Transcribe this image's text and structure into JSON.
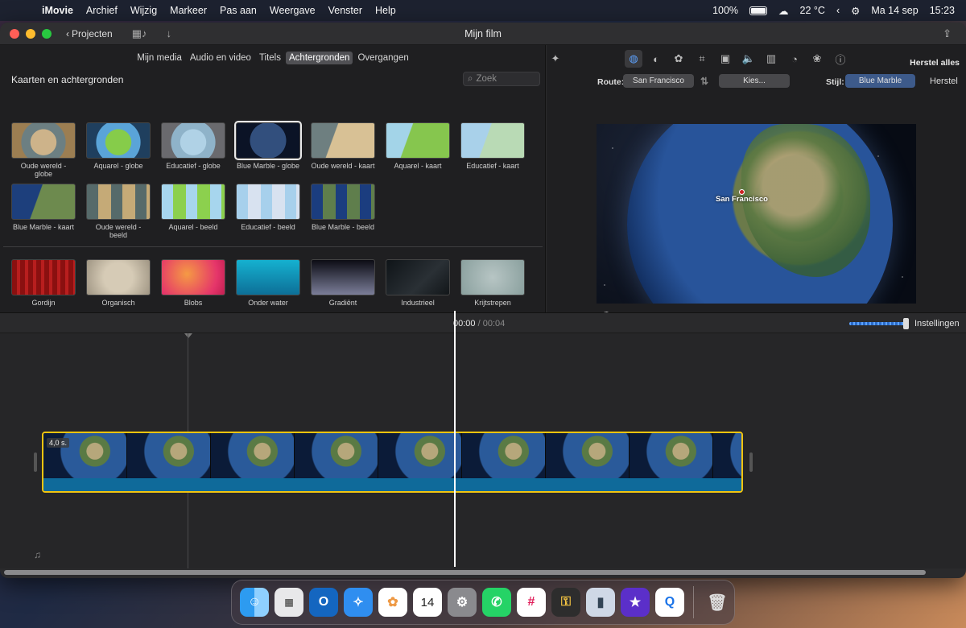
{
  "menubar": {
    "app": "iMovie",
    "items": [
      "Archief",
      "Wijzig",
      "Markeer",
      "Pas aan",
      "Weergave",
      "Venster",
      "Help"
    ],
    "battery": "100%",
    "weather": "22 °C",
    "date": "Ma 14 sep",
    "time": "15:23"
  },
  "titlebar": {
    "back_label": "Projecten",
    "title": "Mijn film"
  },
  "browser": {
    "tabs": [
      "Mijn media",
      "Audio en video",
      "Titels",
      "Achtergronden",
      "Overgangen"
    ],
    "active_tab": "Achtergronden",
    "header": "Kaarten en achtergronden",
    "search_placeholder": "Zoek",
    "maps": [
      "Oude wereld - globe",
      "Aquarel - globe",
      "Educatief - globe",
      "Blue Marble - globe",
      "Oude wereld - kaart",
      "Aquarel - kaart",
      "Educatief - kaart",
      "Blue Marble - kaart",
      "Oude wereld - beeld",
      "Aquarel - beeld",
      "Educatief - beeld",
      "Blue Marble - beeld"
    ],
    "selected_map": "Blue Marble - globe",
    "backgrounds": [
      "Gordijn",
      "Organisch",
      "Blobs",
      "Onder water",
      "Gradiënt",
      "Industrieel",
      "Krijtstrepen"
    ]
  },
  "viewer": {
    "reset_all": "Herstel alles",
    "route_label": "Route:",
    "route_value": "San Francisco",
    "choose_button": "Kies...",
    "style_label": "Stijl:",
    "style_value": "Blue Marble",
    "reset": "Herstel",
    "map_label": "San Francisco"
  },
  "timeline": {
    "current_time": "00:00",
    "separator": "/",
    "duration": "00:04",
    "settings": "Instellingen",
    "clip_duration": "4,0 s."
  },
  "dock": {
    "apps": [
      "finder",
      "launchpad",
      "outlook",
      "safari",
      "photos",
      "calendar",
      "system-settings",
      "whatsapp",
      "slack",
      "keychain",
      "apple-configurator",
      "imovie",
      "quicktime",
      "trash"
    ],
    "calendar_day": "14"
  }
}
